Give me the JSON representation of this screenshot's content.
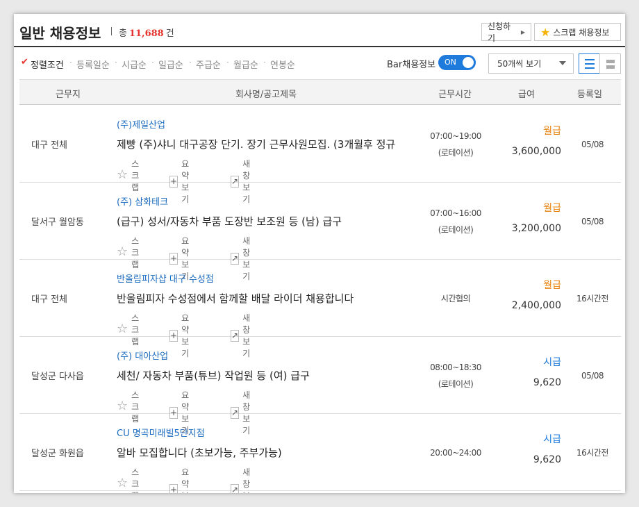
{
  "header": {
    "title": "일반 채용정보",
    "total_prefix": "총",
    "total_count": "11,688",
    "total_suffix": "건",
    "apply_button": "신청하기",
    "scrap_button": "스크랩 채용정보"
  },
  "sortbar": {
    "sorts": [
      "정렬조건",
      "등록일순",
      "시급순",
      "일급순",
      "주급순",
      "월급순",
      "연봉순"
    ],
    "bar_label": "Bar채용정보",
    "toggle_label": "ON",
    "toggle_on": true,
    "page_size": "50개씩 보기",
    "view_mode": "list"
  },
  "table": {
    "headers": [
      "근무지",
      "회사명/공고제목",
      "근무시간",
      "급여",
      "등록일"
    ],
    "actions": [
      "스크랩",
      "요약보기",
      "새창보기"
    ],
    "rows": [
      {
        "location": "대구 전체",
        "company": "(주)제일산업",
        "title": "제빵 (주)샤니 대구공장 단기. 장기 근무사원모집. (3개월후 정규",
        "hours": "07:00~19:00",
        "shift": "(로테이션)",
        "pay_type": "월급",
        "pay": "3,600,000",
        "date": "05/08"
      },
      {
        "location": "달서구 월암동",
        "company": "(주) 삼화테크",
        "title": "(급구) 성서/자동차 부품 도장반 보조원 등 (남) 급구",
        "hours": "07:00~16:00",
        "shift": "(로테이션)",
        "pay_type": "월급",
        "pay": "3,200,000",
        "date": "05/08"
      },
      {
        "location": "대구 전체",
        "company": "반올림피자샵 대구 수성점",
        "title": "반올림피자 수성점에서 함께할 배달 라이더 채용합니다",
        "hours": "시간협의",
        "shift": "",
        "pay_type": "월급",
        "pay": "2,400,000",
        "date": "16시간전"
      },
      {
        "location": "달성군 다사읍",
        "company": "(주) 대아산업",
        "title": "세천/ 자동차 부품(튜브) 작업원 등 (여) 급구",
        "hours": "08:00~18:30",
        "shift": "(로테이션)",
        "pay_type": "시급",
        "pay": "9,620",
        "date": "05/08"
      },
      {
        "location": "달성군 화원읍",
        "company": "CU 명곡미래빌5단지점",
        "title": "알바 모집합니다 (초보가능, 주부가능)",
        "hours": "20:00~24:00",
        "shift": "",
        "pay_type": "시급",
        "pay": "9,620",
        "date": "16시간전"
      }
    ]
  },
  "colors": {
    "accent": "#1e7bdc",
    "count": "#e5322d",
    "monthly": "#e8820c",
    "hourly": "#1e7bdc"
  }
}
